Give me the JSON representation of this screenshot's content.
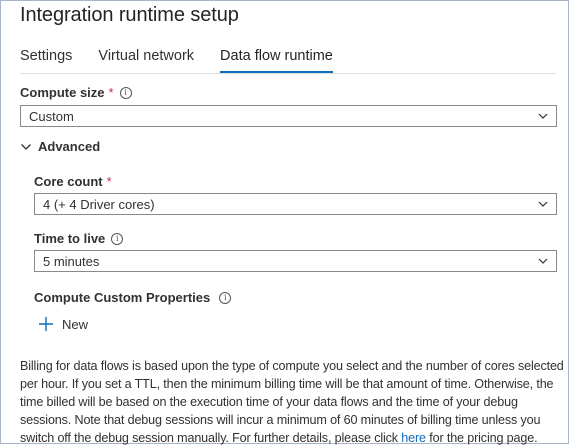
{
  "panel": {
    "title": "Integration runtime setup"
  },
  "tabs": [
    {
      "label": "Settings"
    },
    {
      "label": "Virtual network"
    },
    {
      "label": "Data flow runtime"
    }
  ],
  "compute_size": {
    "label": "Compute size",
    "required": "*",
    "value": "Custom"
  },
  "advanced": {
    "label": "Advanced",
    "expanded": true
  },
  "core_count": {
    "label": "Core count",
    "required": "*",
    "value": "4 (+ 4 Driver cores)"
  },
  "time_to_live": {
    "label": "Time to live",
    "value": "5 minutes"
  },
  "custom_properties": {
    "label": "Compute Custom Properties",
    "new_label": "New"
  },
  "billing": {
    "text_before": "Billing for data flows is based upon the type of compute you select and the number of cores selected per hour. If you set a TTL, then the minimum billing time will be that amount of time. Otherwise, the time billed will be based on the execution time of your data flows and the time of your debug sessions. Note that debug sessions will incur a minimum of 60 minutes of billing time unless you switch off the debug session manually. For further details, please click ",
    "link_text": "here",
    "text_after": " for the pricing page."
  },
  "colors": {
    "accent": "#0f6cbd",
    "required": "#c4314b",
    "border": "#8a8886"
  },
  "icons": {
    "info": "info-icon",
    "chevron_down": "chevron-down-icon",
    "plus": "plus-icon"
  }
}
